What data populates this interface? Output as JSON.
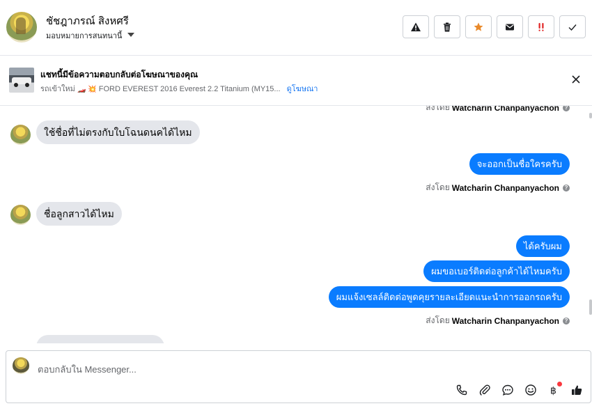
{
  "header": {
    "contact_name": "ชัชฎาภรณ์ สิงหศรี",
    "assign_label": "มอบหมายการสนทนานี้",
    "actions": [
      {
        "name": "report-spam-button",
        "icon": "warning-icon"
      },
      {
        "name": "delete-button",
        "icon": "trash-icon"
      },
      {
        "name": "star-button",
        "icon": "star-icon",
        "color": "#e98a2b"
      },
      {
        "name": "mark-unread-button",
        "icon": "envelope-icon"
      },
      {
        "name": "follow-up-button",
        "icon": "exclamation-icon",
        "color": "#e02424"
      },
      {
        "name": "mark-done-button",
        "icon": "check-icon"
      }
    ]
  },
  "ad_banner": {
    "title": "แชทนี้มีข้อความตอบกลับต่อโฆษณาของคุณ",
    "subtitle_prefix": "รถเข้าใหม่",
    "subtitle_emoji": "🏎️ 💥",
    "subtitle_text": "FORD EVEREST 2016 Everest 2.2 Titanium (MY15...",
    "link_label": "ดูโฆษณา"
  },
  "conversation": {
    "sent_by_prefix": "ส่งโดย",
    "agent_name": "Watcharin Chanpanyachon",
    "messages": [
      {
        "direction": "in",
        "text": "ใช้ชื่อที่ไม่ตรงกับใบโฉนดนคได้ไหม"
      },
      {
        "direction": "out",
        "text": "จะออกเป็นชื่อใครครับ"
      },
      {
        "direction": "in",
        "text": "ชื่อลูกสาวได้ไหม"
      },
      {
        "direction": "out",
        "text": "ได้ครับผม"
      },
      {
        "direction": "out",
        "text": "ผมขอเบอร์ติดต่อลูกค้าได้ไหมครับ"
      },
      {
        "direction": "out",
        "text": "ผมแจ้งเซลล์ติดต่อพูดคุยรายละเอียดแนะนำการออกรถครับ"
      }
    ]
  },
  "composer": {
    "placeholder": "ตอบกลับใน Messenger...",
    "tools": [
      "phone-icon",
      "paperclip-icon",
      "saved-reply-icon",
      "emoji-icon",
      "baht-payment-icon",
      "thumbs-up-icon"
    ]
  },
  "colors": {
    "outgoing_bubble": "#0a7cff",
    "incoming_bubble": "#e4e6eb",
    "link": "#1877f2"
  }
}
